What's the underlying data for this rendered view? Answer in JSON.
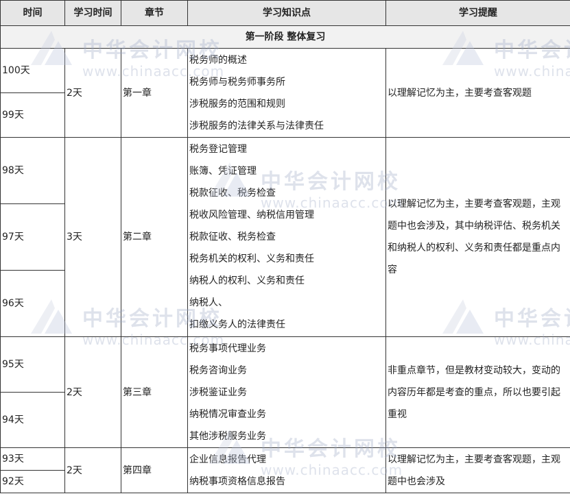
{
  "headers": [
    "时间",
    "学习时间",
    "章节",
    "学习知识点",
    "学习提醒"
  ],
  "stage_title": "第一阶段 整体复习",
  "groups": [
    {
      "days": [
        "100天",
        "99天"
      ],
      "study_time": "2天",
      "chapter": "第一章",
      "points": [
        "税务师的概述",
        "税务师与税务师事务所",
        "涉税服务的范围和规则",
        "涉税服务的法律关系与法律责任"
      ],
      "tip": "以理解记忆为主，主要考查客观题"
    },
    {
      "days": [
        "98天",
        "97天",
        "96天"
      ],
      "study_time": "3天",
      "chapter": "第二章",
      "points": [
        "税务登记管理",
        "账簿、凭证管理",
        "税款征收、税务检查",
        "税收风险管理、纳税信用管理",
        "税款征收、税务检查",
        "税务机关的权利、义务和责任",
        "纳税人的权利、义务和责任",
        "纳税人、",
        "扣缴义务人的法律责任"
      ],
      "tip": "以理解记忆为主，主要考查客观题，主观题中也会涉及，其中纳税评估、税务机关和纳税人的权利、义务和责任都是重点内容"
    },
    {
      "days": [
        "95天",
        "94天"
      ],
      "study_time": "2天",
      "chapter": "第三章",
      "points": [
        "税务事项代理业务",
        "税务咨询业务",
        "涉税鉴证业务",
        "纳税情况审查业务",
        "其他涉税服务业务"
      ],
      "tip": "非重点章节，但是教材变动较大，变动的内容历年都是考查的重点，所以也要引起重视"
    },
    {
      "days": [
        "93天",
        "92天"
      ],
      "study_time": "2天",
      "chapter": "第四章",
      "points": [
        "企业信息报告代理",
        "纳税事项资格信息报告"
      ],
      "tip": "以理解记忆为主，主要考查客观题，主观题中也会涉及"
    }
  ],
  "watermark": {
    "cn": "中华会计网校",
    "en": "www.chinaacc.com"
  }
}
